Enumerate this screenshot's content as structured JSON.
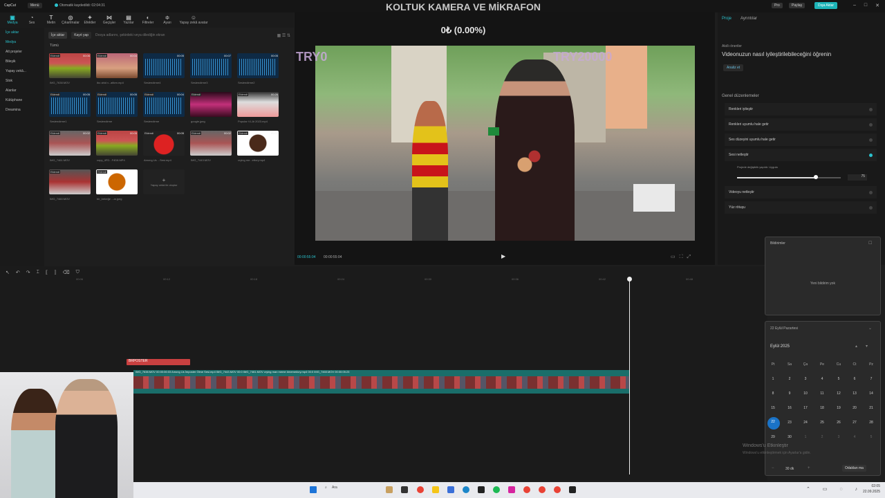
{
  "app": {
    "name": "CapCut",
    "menu": "Menü",
    "autosave": "Otomatik kaydedildi: 02:04:31",
    "pro": "Pro",
    "pay": "Paylaş",
    "export": "Dışa Aktar"
  },
  "overlay": {
    "title": "KOLTUK KAMERA VE MİKRAFON",
    "price": "0₺ (0.00%)",
    "try_left": "TRY0",
    "try_right": "TRY20000"
  },
  "toolbar": {
    "items": [
      "Medya",
      "Ses",
      "Metin",
      "Çıkartmalar",
      "Efektler",
      "Geçişler",
      "Yazılar",
      "Filtreler",
      "Ayarı",
      "Yapay zekâ avatar"
    ]
  },
  "sidebar": {
    "items": [
      "İçe aktar",
      "Medya",
      "Alt projeler",
      "Bileşik",
      "Yapay zekâ...",
      "Stok",
      "Alanlar",
      "Kütüphane",
      "Dreamina"
    ]
  },
  "media": {
    "import": "İçe aktar",
    "record": "Kayıt yap",
    "search_placeholder": "Dosya adlarını, şekirdeki veya dilediğin ekran",
    "all": "Tümü",
    "items": [
      {
        "label": "IMG_7638.MOV",
        "badge": "Eklendi",
        "dur": "00:06"
      },
      {
        "label": "ibo ahid v...afken.mp4",
        "badge": "Eklendi",
        "dur": "00:04"
      },
      {
        "label": "Seslendirme4",
        "badge": "",
        "dur": "00:05"
      },
      {
        "label": "Seslendirme3",
        "badge": "",
        "dur": "00:07"
      },
      {
        "label": "Seslendirme2",
        "badge": "",
        "dur": "00:05"
      },
      {
        "label": "Seslendirme1",
        "badge": "Eklendi",
        "dur": "00:05"
      },
      {
        "label": "Seslendirme",
        "badge": "Eklendi",
        "dur": "00:05"
      },
      {
        "label": "Seslendirme",
        "badge": "Eklendi",
        "dur": "00:04"
      },
      {
        "label": "google.jpeg",
        "badge": "Eklendi",
        "dur": ""
      },
      {
        "label": "Popular VLJ# 2023.mp4",
        "badge": "Eklendi",
        "dur": "00:26"
      },
      {
        "label": "IMG_7461.MOV",
        "badge": "Eklendi",
        "dur": "00:02"
      },
      {
        "label": "copy_4FD...F4D8.MP4",
        "badge": "Eklendi",
        "dur": "00:05"
      },
      {
        "label": "Among Us ...Sesi.mp4",
        "badge": "Eklendi",
        "dur": "00:05"
      },
      {
        "label": "IMG_7443.MOV",
        "badge": "Eklendi",
        "dur": "00:02"
      },
      {
        "label": "crying me...ettory.mp4",
        "badge": "Eklendi",
        "dur": "00:07"
      },
      {
        "label": "IMG_7460.MOV",
        "badge": "Eklendi",
        "dur": ""
      },
      {
        "label": "bir_bebeğe ...ar.jpeg",
        "badge": "Eklendi",
        "dur": ""
      }
    ],
    "add_more": "Yapay zekâ ile oluştur"
  },
  "preview": {
    "time_current": "00:00:55:04",
    "time_total": "00:00:55:04"
  },
  "right": {
    "tabs": [
      "Proje",
      "Ayrıntılar"
    ],
    "ai_title": "Akıllı öneriler",
    "ai_link": "Videonuzun nasıl iyileştirilebileceğini öğrenin",
    "analyze": "Analiz et",
    "general": "Genel düzenlemeler",
    "options": [
      {
        "label": "Renkleri iyileştir",
        "on": false
      },
      {
        "label": "Renkleri uyumlu hale getir",
        "on": false
      },
      {
        "label": "Ses düzeyini uyumlu hale getir",
        "on": false
      },
      {
        "label": "Sesi netleştir",
        "on": true
      },
      {
        "label": "Videoyu netleştir",
        "on": false
      },
      {
        "label": "Yüz rötuşu",
        "on": false
      }
    ],
    "slider_caption": "Projede değişiklik yapıldı: Uygula",
    "slider_val": "75"
  },
  "timeline": {
    "text_clip": "BRPOSTER",
    "track_label": "IMG_7638.MOV 00:00:06:03   Among Us İmposter Ölme Sesi.mp4   IMG_7443.MOV 00:0   IMG_7461.MOV   crying man meme #meme#cry.mp4 00:0   IMG_7460.MOV 00:00:05:23",
    "ticks": [
      "00:06",
      "00:12",
      "00:18",
      "00:24",
      "00:30",
      "00:36",
      "00:42",
      "00:48"
    ]
  },
  "notifications": {
    "title": "Bildirimler",
    "empty": "Yeni bildirim yok"
  },
  "calendar": {
    "date": "22 Eylül Pazartesi",
    "month": "Eylül 2025",
    "headers": [
      "Pt",
      "Sa",
      "Ça",
      "Pe",
      "Cu",
      "Ct",
      "Pz"
    ],
    "rows": [
      [
        "1",
        "2",
        "3",
        "4",
        "5",
        "6",
        "7"
      ],
      [
        "8",
        "9",
        "10",
        "11",
        "12",
        "13",
        "14"
      ],
      [
        "15",
        "16",
        "17",
        "18",
        "19",
        "20",
        "21"
      ],
      [
        "22",
        "23",
        "24",
        "25",
        "26",
        "27",
        "28"
      ],
      [
        "29",
        "30",
        "1",
        "2",
        "3",
        "4",
        "5"
      ]
    ],
    "focus_val": "30 dk",
    "focus_btn": "Odaklan ma"
  },
  "windows": {
    "activate": "Windows'u Etkinleştir",
    "activate_sub": "Windows'u etkinleştirmek için Ayarlar'a gidin."
  },
  "taskbar": {
    "search": "Ara",
    "time": "02:05",
    "date": "22.09.2025"
  }
}
